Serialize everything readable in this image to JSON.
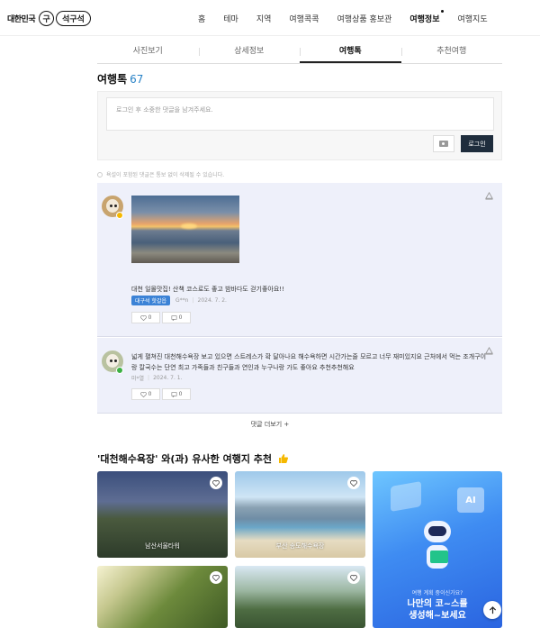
{
  "header": {
    "logo_left": "대한민국",
    "logo_mark": "구",
    "logo_right": "석구석",
    "nav": [
      "홈",
      "테마",
      "지역",
      "여행콕콕",
      "여행상품 홍보관",
      "여행정보",
      "여행지도"
    ],
    "nav_active_index": 5
  },
  "subtabs": [
    "사진보기",
    "상세정보",
    "여행톡",
    "추천여행"
  ],
  "subtab_active_index": 2,
  "talk": {
    "title": "여행톡",
    "count": "67",
    "placeholder": "로그인 후 소중한 댓글을 남겨주세요.",
    "login_label": "로그인",
    "notice": "욕설이 포함된 댓글은 통보 없이 삭제될 수 있습니다."
  },
  "comments": [
    {
      "text": "대천 일몰맛집! 산책 코스로도 좋고 밤바다도 걷기좋아요!!",
      "badge": "대구석 핫갈읍",
      "user": "G**n",
      "date": "2024. 7. 2.",
      "likes": "0",
      "replies": "0",
      "badge_color": "#f5b800"
    },
    {
      "text": "넓게 펼쳐진 대천해수욕장 보고 있으면 스트레스가 확 달아나요 해수욕하면 시간가는줄 모르고 너무 재미있지요 근처에서 먹는 조개구이랑 칼국수는 단연 최고 가족들과 친구들과 연인과 누구나랑 가도 좋아요 추천추천해요",
      "user": "미*열",
      "date": "2024. 7. 1.",
      "likes": "0",
      "replies": "0",
      "badge_color": "#3cb043"
    }
  ],
  "more_label": "댓글 더보기 +",
  "recommend": {
    "title": "'대천해수욕장' 와(과) 유사한 여행지 추천",
    "cards": [
      "남산서울타워",
      "부산 송도해수욕장"
    ],
    "ai_sub": "여행 계획 중이신가요?",
    "ai_main_line1": "나만의 코~스를",
    "ai_main_line2": "생성해~보세요",
    "ai_badge": "AI"
  },
  "colors": {
    "accent_count": "#2a83c7",
    "login_button": "#1f2d3d",
    "badge_blue": "#3b82d6",
    "comment_bg": "#eef0fa"
  }
}
